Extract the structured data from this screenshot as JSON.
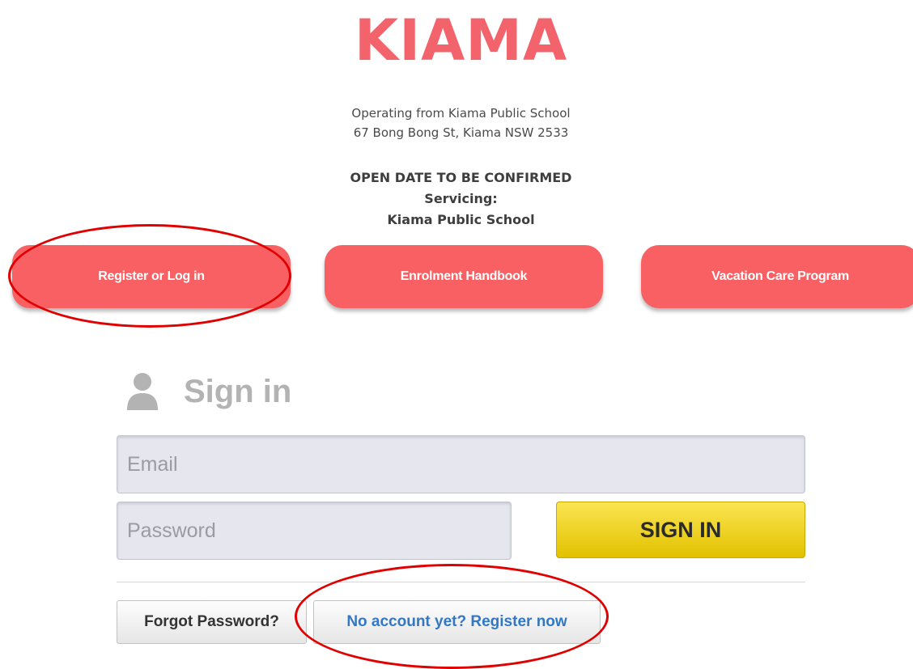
{
  "header": {
    "brand": "KIAMA",
    "address_line1": "Operating from Kiama Public School",
    "address_line2": "67 Bong Bong St, Kiama NSW 2533",
    "notice": "OPEN DATE TO BE CONFIRMED",
    "servicing_label": "Servicing:",
    "servicing_school": "Kiama Public School"
  },
  "nav_buttons": [
    {
      "label": "Register or Log in"
    },
    {
      "label": "Enrolment Handbook"
    },
    {
      "label": "Vacation Care Program"
    }
  ],
  "signin": {
    "title": "Sign in",
    "icon": "user-icon",
    "email_placeholder": "Email",
    "password_placeholder": "Password",
    "submit_label": "SIGN IN",
    "forgot_label": "Forgot Password?",
    "register_label": "No account yet? Register now"
  },
  "colors": {
    "brand": "#f2636b",
    "pill": "#f96063",
    "signin_button": "#f0d22a",
    "register_link": "#3278c4",
    "annotation": "#e00000"
  }
}
